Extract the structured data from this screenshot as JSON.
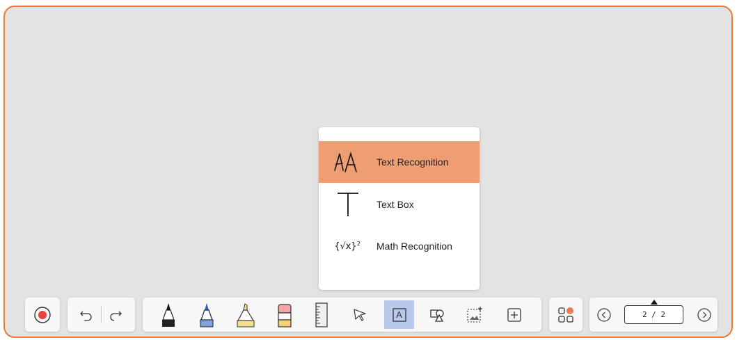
{
  "menu": {
    "items": [
      {
        "label": "Text Recognition",
        "icon": "handwriting-aa-icon",
        "selected": true
      },
      {
        "label": "Text Box",
        "icon": "text-t-icon",
        "selected": false
      },
      {
        "label": "Math Recognition",
        "icon": "math-sqrt-icon",
        "selected": false
      },
      {
        "math_symbol": "{√x}",
        "math_sup": "2"
      }
    ]
  },
  "toolbar": {
    "record": {
      "icon": "record-icon"
    },
    "history": {
      "undo": "undo-icon",
      "redo": "redo-icon"
    },
    "tools": [
      {
        "icon": "pen-black-icon"
      },
      {
        "icon": "pen-blue-icon"
      },
      {
        "icon": "highlighter-icon"
      },
      {
        "icon": "eraser-icon"
      },
      {
        "icon": "ruler-icon"
      },
      {
        "icon": "select-cursor-icon"
      },
      {
        "icon": "text-tool-icon",
        "active": true,
        "glyph": "A"
      },
      {
        "icon": "shapes-icon"
      },
      {
        "icon": "image-add-icon"
      },
      {
        "icon": "add-icon"
      }
    ],
    "apps": {
      "icon": "apps-grid-icon"
    },
    "pager": {
      "prev": "chevron-left-icon",
      "next": "chevron-right-icon",
      "label": "2 / 2"
    }
  },
  "colors": {
    "border_accent": "#ef7a2e",
    "selected_item": "#ef9e74",
    "active_tool": "#b9c9ec",
    "record_red": "#e8423f"
  }
}
